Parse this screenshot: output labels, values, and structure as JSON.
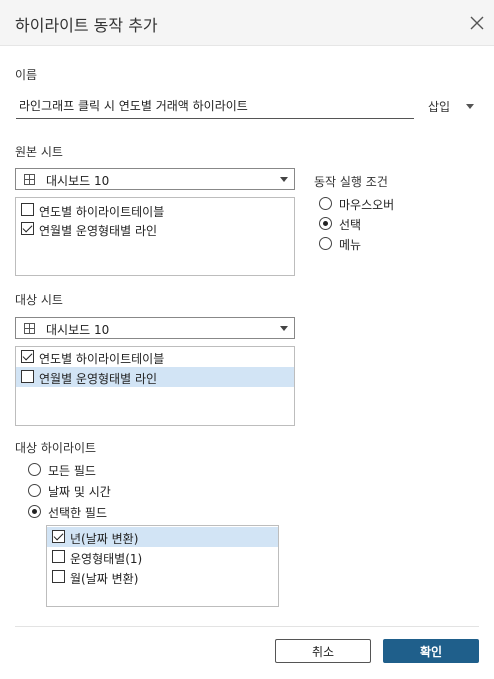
{
  "dialog": {
    "title": "하이라이트 동작 추가"
  },
  "name_section": {
    "label": "이름",
    "value": "라인그래프 클릭 시 연도별 거래액 하이라이트",
    "insert_label": "삽입"
  },
  "source": {
    "label": "원본 시트",
    "dropdown_value": "대시보드 10",
    "items": [
      {
        "label": "연도별 하이라이트테이블",
        "checked": false
      },
      {
        "label": "연월별 운영형태별 라인",
        "checked": true
      }
    ]
  },
  "run_condition": {
    "label": "동작 실행 조건",
    "options": [
      {
        "label": "마우스오버",
        "checked": false
      },
      {
        "label": "선택",
        "checked": true
      },
      {
        "label": "메뉴",
        "checked": false
      }
    ]
  },
  "target": {
    "label": "대상 시트",
    "dropdown_value": "대시보드 10",
    "items": [
      {
        "label": "연도별 하이라이트테이블",
        "checked": true
      },
      {
        "label": "연월별 운영형태별 라인",
        "checked": false
      }
    ]
  },
  "target_highlight": {
    "label": "대상 하이라이트",
    "options": [
      {
        "label": "모든 필드",
        "checked": false
      },
      {
        "label": "날짜 및 시간",
        "checked": false
      },
      {
        "label": "선택한 필드",
        "checked": true
      }
    ],
    "fields": [
      {
        "label": "년(날짜 변환)",
        "checked": true
      },
      {
        "label": "운영형태별(1)",
        "checked": false
      },
      {
        "label": "월(날짜 변환)",
        "checked": false
      }
    ]
  },
  "buttons": {
    "cancel": "취소",
    "ok": "확인"
  }
}
